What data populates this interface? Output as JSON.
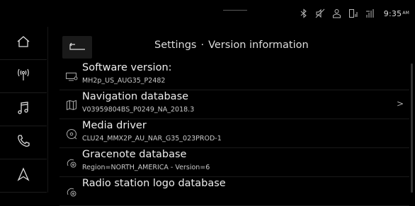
{
  "status": {
    "time": "9:35",
    "ampm": "AM"
  },
  "header": {
    "section": "Settings",
    "separator": "·",
    "page": "Version information"
  },
  "sidebar": {
    "items": [
      {
        "icon": "home-icon"
      },
      {
        "icon": "radio-icon"
      },
      {
        "icon": "music-icon"
      },
      {
        "icon": "phone-icon"
      },
      {
        "icon": "navigation-icon"
      }
    ]
  },
  "versions": [
    {
      "name": "Software version:",
      "value": "MH2p_US_AUG35_P2482",
      "icon": "software-icon",
      "has_chevron": false
    },
    {
      "name": "Navigation database",
      "value": "V03959804BS_P0249_NA_2018.3",
      "icon": "map-icon",
      "has_chevron": true,
      "chevron": ">"
    },
    {
      "name": "Media driver",
      "value": "CLU24_MMX2P_AU_NAR_G35_023PROD-1",
      "icon": "media-icon",
      "has_chevron": false
    },
    {
      "name": "Gracenote database",
      "value": "Region=NORTH_AMERICA - Version=6",
      "icon": "gracenote-icon",
      "has_chevron": false
    },
    {
      "name": "Radio station logo database",
      "value": "",
      "icon": "radio-logo-icon",
      "has_chevron": false
    }
  ]
}
